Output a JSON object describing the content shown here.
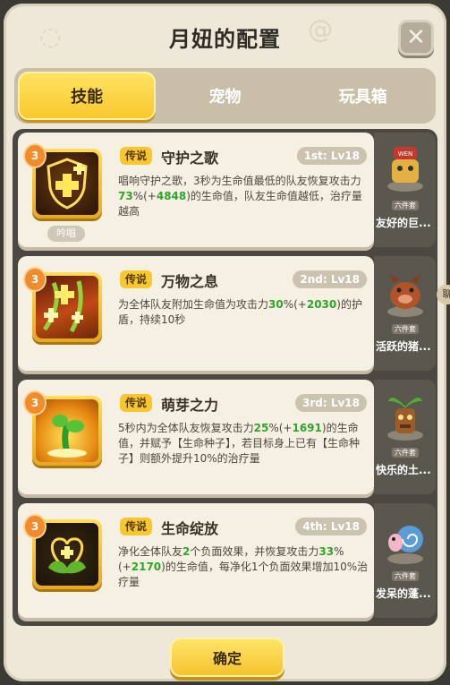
{
  "dialog": {
    "title": "月妞的配置",
    "close_icon": "close-icon"
  },
  "tabs": [
    {
      "label": "技能",
      "active": true
    },
    {
      "label": "宠物",
      "active": false
    },
    {
      "label": "玩具箱",
      "active": false
    }
  ],
  "skills": [
    {
      "level_badge": "3",
      "cast_tag": "吟唱",
      "rarity": "传说",
      "name": "守护之歌",
      "slot": "1st: Lv18",
      "desc_parts": [
        "唱响守护之歌，3秒为生命值最低的队友恢复攻击力",
        "73",
        "%(+",
        "4848",
        ")的生命值，队友生命值越低，治疗量越高"
      ],
      "icon": "shield-cross-icon"
    },
    {
      "level_badge": "3",
      "rarity": "传说",
      "name": "万物之息",
      "slot": "2nd: Lv18",
      "desc_parts": [
        "为全体队友附加生命值为攻击力",
        "30",
        "%(+",
        "2030",
        ")的护盾，持续10秒"
      ],
      "icon": "breath-cross-icon"
    },
    {
      "level_badge": "3",
      "rarity": "传说",
      "name": "萌芽之力",
      "slot": "3rd: Lv18",
      "desc_parts": [
        "5秒内为全体队友恢复攻击力",
        "25",
        "%(+",
        "1691",
        ")的生命值，并赋予【生命种子】，若目标身上已有【生命种子】则额外提升10%的治疗量"
      ],
      "icon": "sprout-icon"
    },
    {
      "level_badge": "3",
      "rarity": "传说",
      "name": "生命绽放",
      "slot": "4th: Lv18",
      "desc_parts": [
        "净化全体队友",
        "2",
        "个负面效果，并恢复攻击力",
        "33",
        "%(+",
        "2170",
        ")的生命值，每净化1个负面效果增加10%治疗量"
      ],
      "icon": "heart-bloom-icon"
    }
  ],
  "pets": [
    {
      "set": "六件套",
      "name": "友好的巨...",
      "badge": "WEN",
      "icon": "pet-robot-icon"
    },
    {
      "set": "六件套",
      "name": "活跃的猪...",
      "icon": "pet-boar-icon"
    },
    {
      "set": "六件套",
      "name": "快乐的土...",
      "icon": "pet-tiki-icon"
    },
    {
      "set": "六件套",
      "name": "发呆的蓬...",
      "icon": "pet-snail-icon"
    }
  ],
  "side_hint": "聊",
  "confirm_label": "确定",
  "colors": {
    "accent_yellow": "#f8c72c",
    "panel_bg": "#efe8d8",
    "highlight_green": "#2fa52b"
  }
}
